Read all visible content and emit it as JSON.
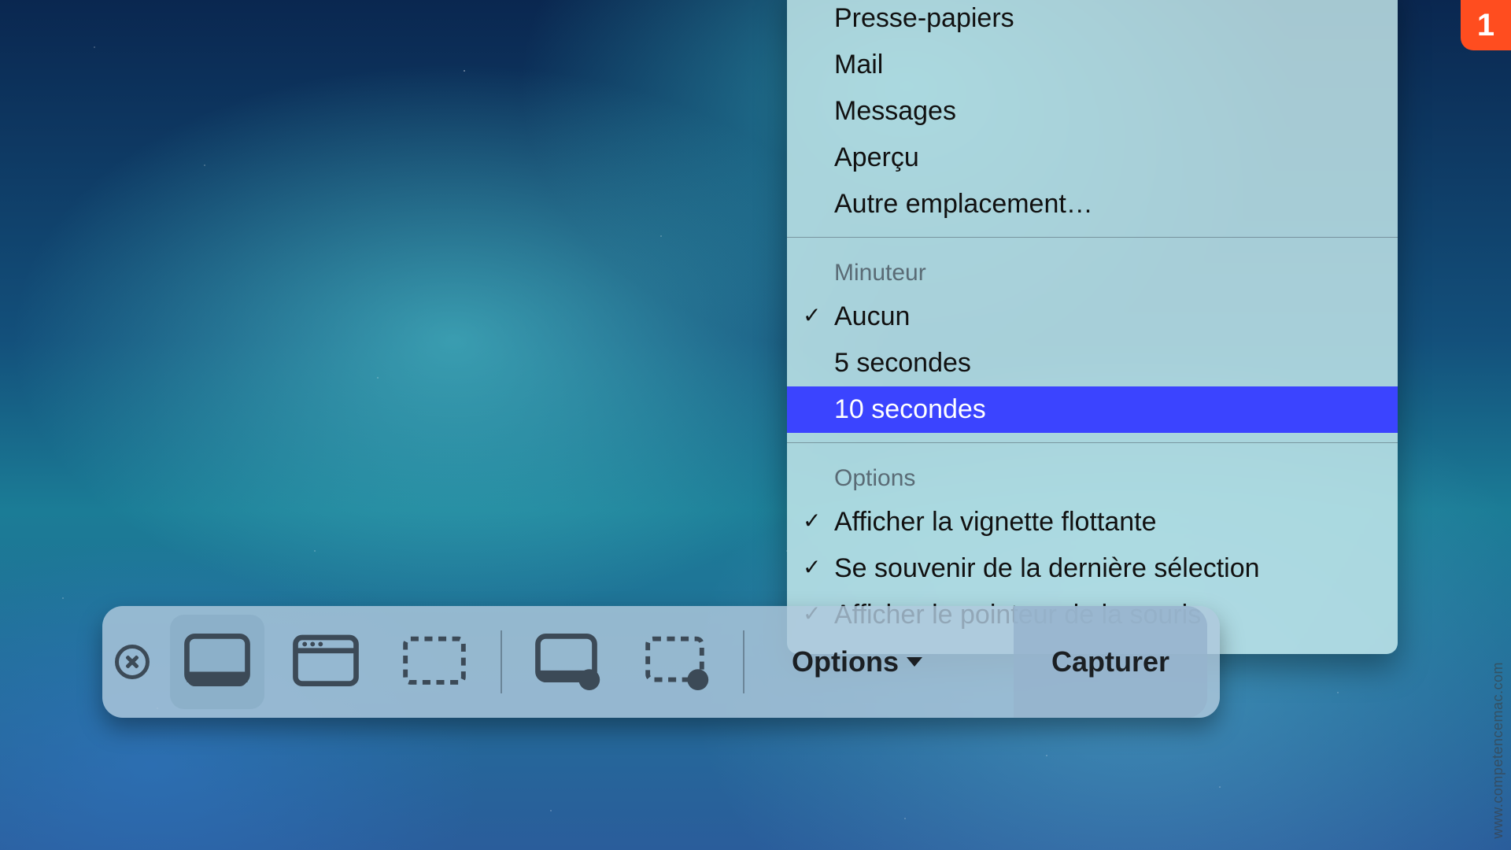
{
  "badge": "1",
  "watermark": "www.competencemac.com",
  "menu": {
    "destinations": [
      "Presse-papiers",
      "Mail",
      "Messages",
      "Aperçu",
      "Autre emplacement…"
    ],
    "timer": {
      "header": "Minuteur",
      "none": "Aucun",
      "five": "5 secondes",
      "ten": "10 secondes"
    },
    "options": {
      "header": "Options",
      "thumbnail": "Afficher la vignette flottante",
      "remember": "Se souvenir de la dernière sélection",
      "pointer": "Afficher le pointeur de la souris"
    }
  },
  "toolbar": {
    "options_label": "Options",
    "capture_label": "Capturer"
  }
}
